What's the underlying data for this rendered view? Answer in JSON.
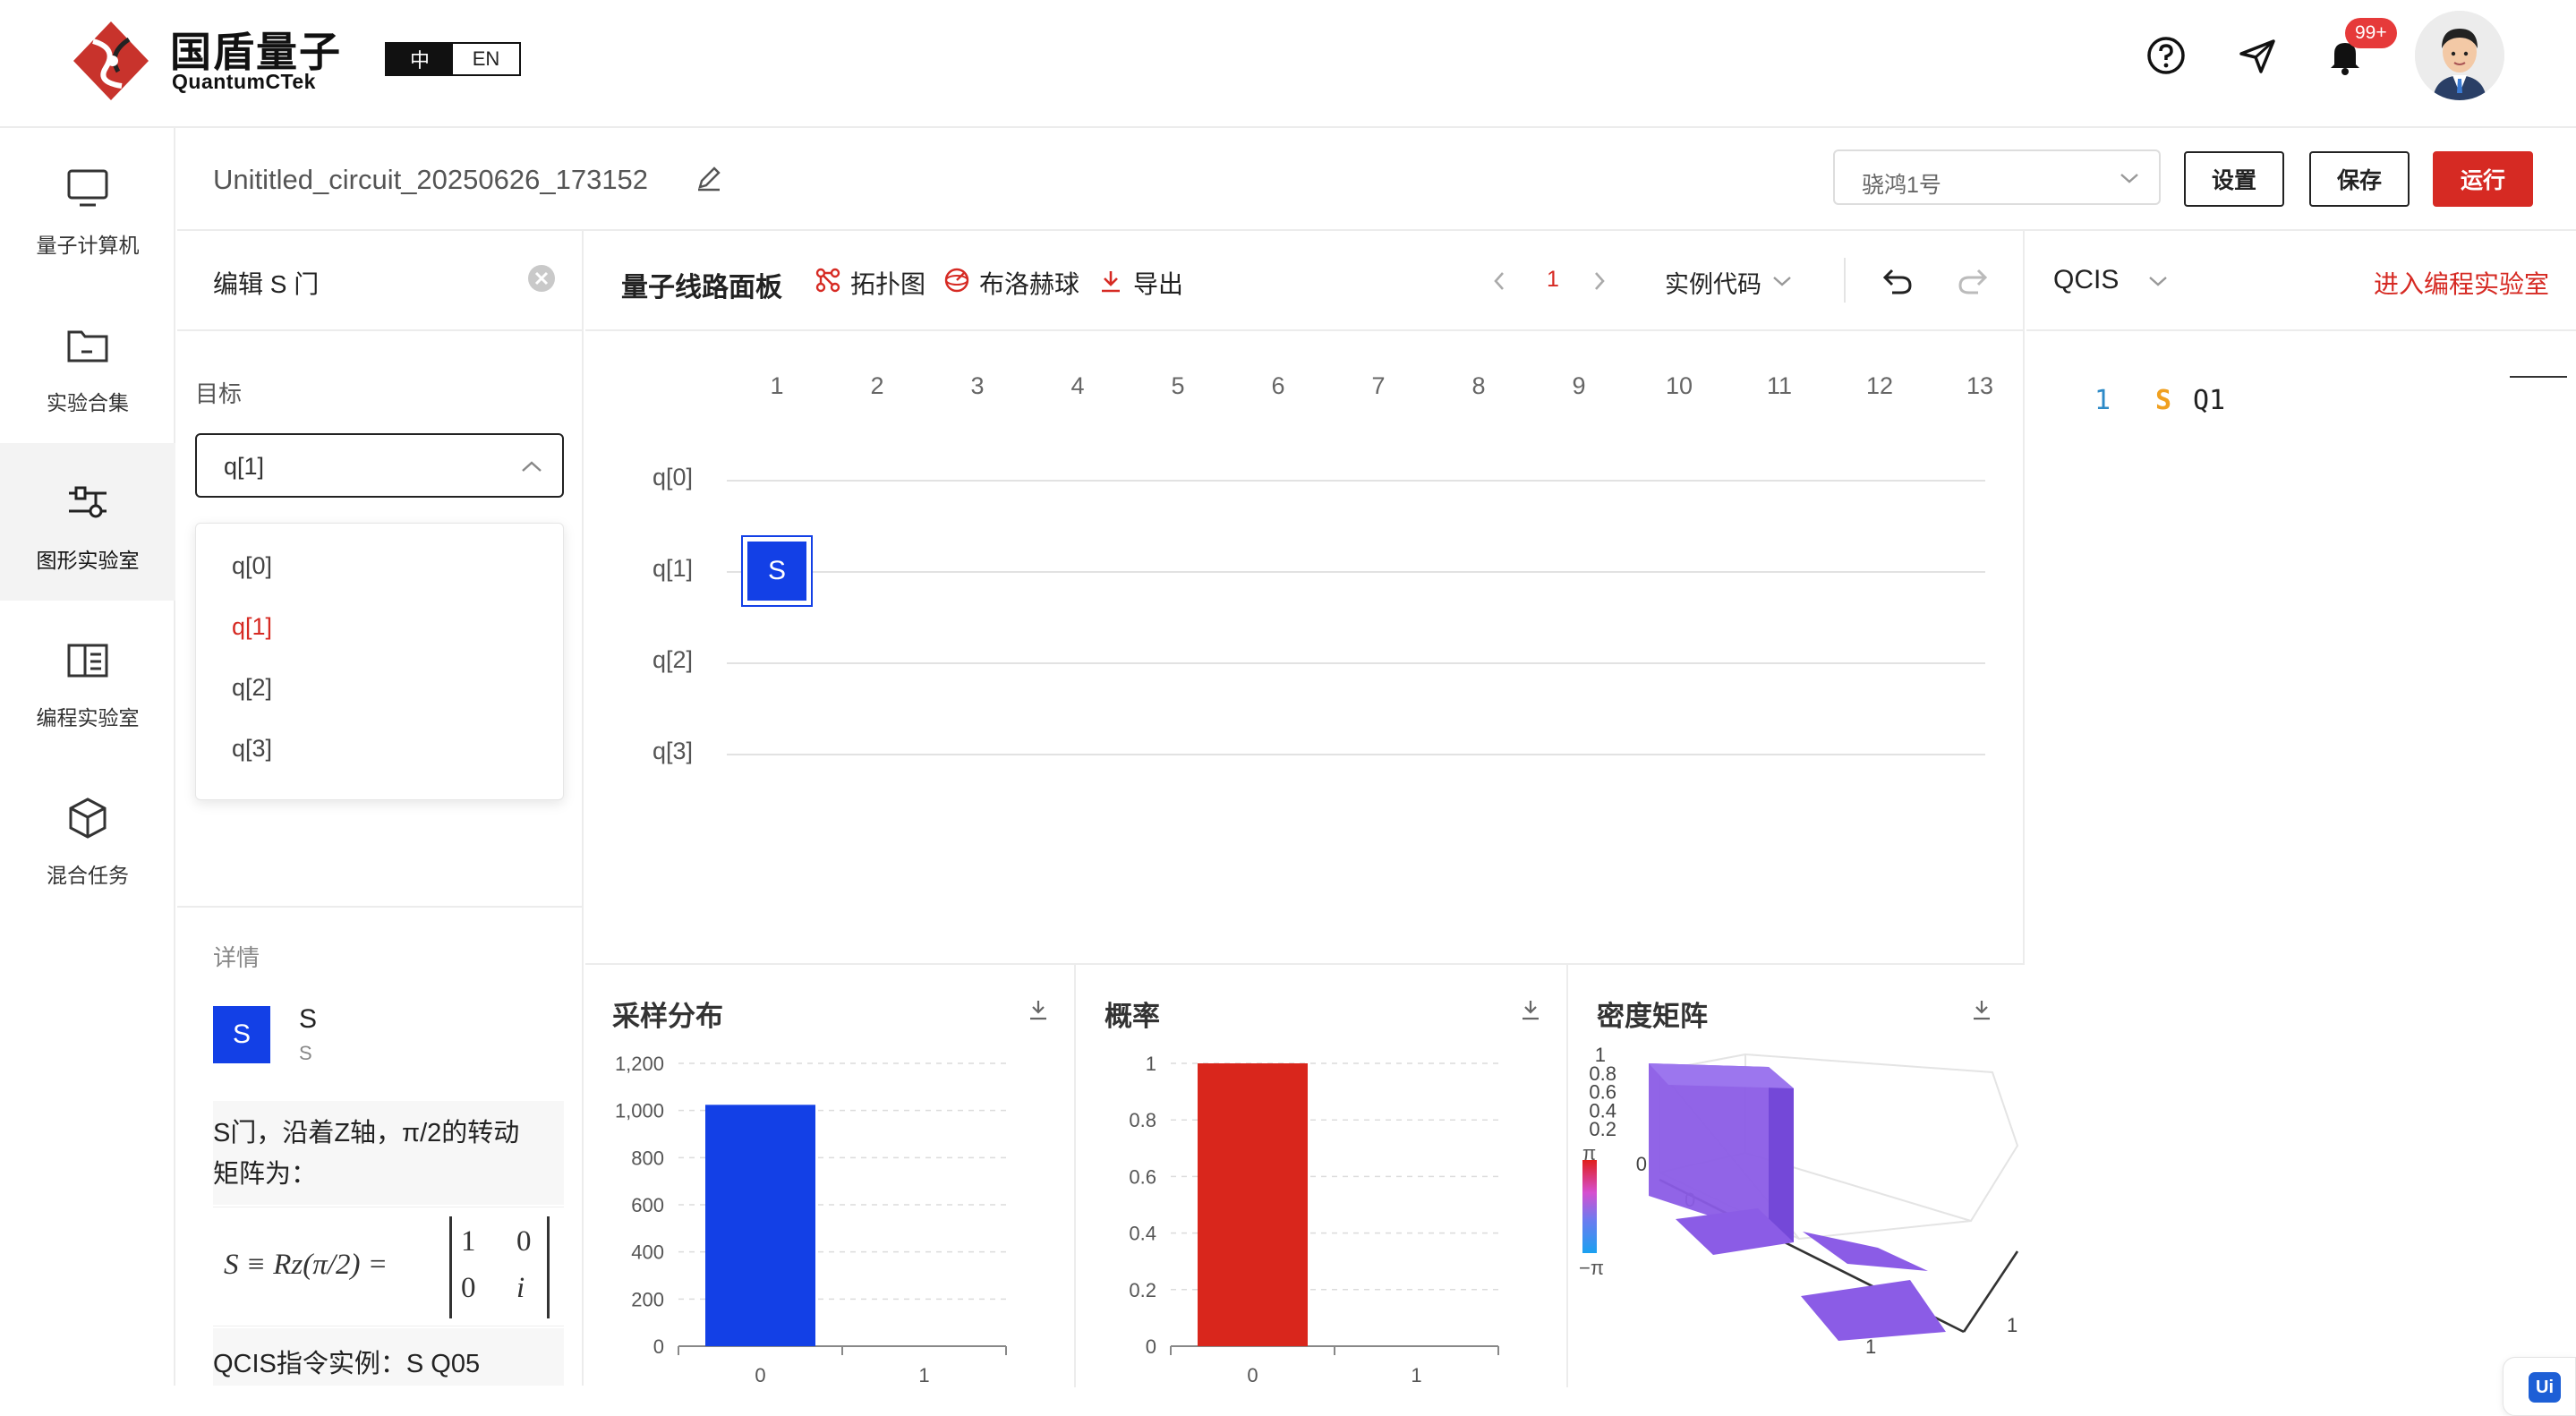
{
  "header": {
    "brand_cn": "国盾量子",
    "brand_en": "QuantumCTek",
    "lang_zh": "中",
    "lang_en": "EN",
    "notif_count": "99+",
    "icons": [
      "help-icon",
      "send-icon",
      "bell-icon"
    ]
  },
  "nav": {
    "items": [
      {
        "label": "量子计算机",
        "icon": "monitor-icon"
      },
      {
        "label": "实验合集",
        "icon": "folder-icon"
      },
      {
        "label": "图形实验室",
        "icon": "circuit-icon"
      },
      {
        "label": "编程实验室",
        "icon": "book-icon"
      },
      {
        "label": "混合任务",
        "icon": "cube-icon"
      }
    ],
    "active": 2
  },
  "toolbar": {
    "circuit_name": "Unititled_circuit_20250626_173152",
    "device": "骁鸿1号",
    "settings": "设置",
    "save": "保存",
    "run": "运行"
  },
  "gate_editor": {
    "title": "编辑 S 门",
    "target_label": "目标",
    "target_value": "q[1]",
    "options": [
      "q[0]",
      "q[1]",
      "q[2]",
      "q[3]"
    ],
    "selected_index": 1,
    "details_label": "详情",
    "gate_symbol": "S",
    "gate_name": "S",
    "gate_sub": "S",
    "desc_1": "S门，沿着Z轴，π/2的转动",
    "desc_2": "矩阵为：",
    "formula": "S ≡ Rz(π/2) =",
    "matrix": [
      "1",
      "0",
      "0",
      "i"
    ],
    "example": "QCIS指令实例：S Q05"
  },
  "circuit": {
    "title": "量子线路面板",
    "topology": "拓扑图",
    "bloch": "布洛赫球",
    "export": "导出",
    "page": "1",
    "examples": "实例代码",
    "columns": [
      "1",
      "2",
      "3",
      "4",
      "5",
      "6",
      "7",
      "8",
      "9",
      "10",
      "11",
      "12",
      "13"
    ],
    "qubits": [
      "q[0]",
      "q[1]",
      "q[2]",
      "q[3]"
    ],
    "gate_label": "S",
    "gate_qubit": 1,
    "gate_col": 0
  },
  "qcis": {
    "title": "QCIS",
    "enter_lab": "进入编程实验室",
    "line_no": "1",
    "code_op": "S",
    "code_arg": "Q1"
  },
  "panels": {
    "sampling": "采样分布",
    "probability": "概率",
    "density": "密度矩阵"
  },
  "chart_data": [
    {
      "type": "bar",
      "title": "采样分布",
      "categories": [
        "0",
        "1"
      ],
      "values": [
        1024,
        0
      ],
      "ylim": [
        0,
        1200
      ],
      "yticks": [
        "0",
        "200",
        "400",
        "600",
        "800",
        "1,000",
        "1,200"
      ],
      "color": "#1340e6",
      "grid": true
    },
    {
      "type": "bar",
      "title": "概率",
      "categories": [
        "0",
        "1"
      ],
      "values": [
        1,
        0
      ],
      "ylim": [
        0,
        1
      ],
      "yticks": [
        "0",
        "0.2",
        "0.4",
        "0.6",
        "0.8",
        "1"
      ],
      "color": "#d9261c",
      "grid": true
    },
    {
      "type": "bar3d",
      "title": "密度矩阵",
      "z_ticks": [
        "0.2",
        "0.4",
        "0.6",
        "0.8",
        "1"
      ],
      "z_zero": "0",
      "axis_x": [
        "0",
        "1"
      ],
      "axis_y": [
        "1"
      ],
      "colorbar": [
        "π",
        "−π"
      ],
      "values": [
        [
          1,
          0
        ],
        [
          0,
          0
        ]
      ],
      "color": "#8b5ce6"
    }
  ],
  "colors": {
    "accent": "#d62a23",
    "gate_blue": "#1340e6",
    "prob_red": "#d9261c",
    "density_purple": "#8b5ce6"
  }
}
